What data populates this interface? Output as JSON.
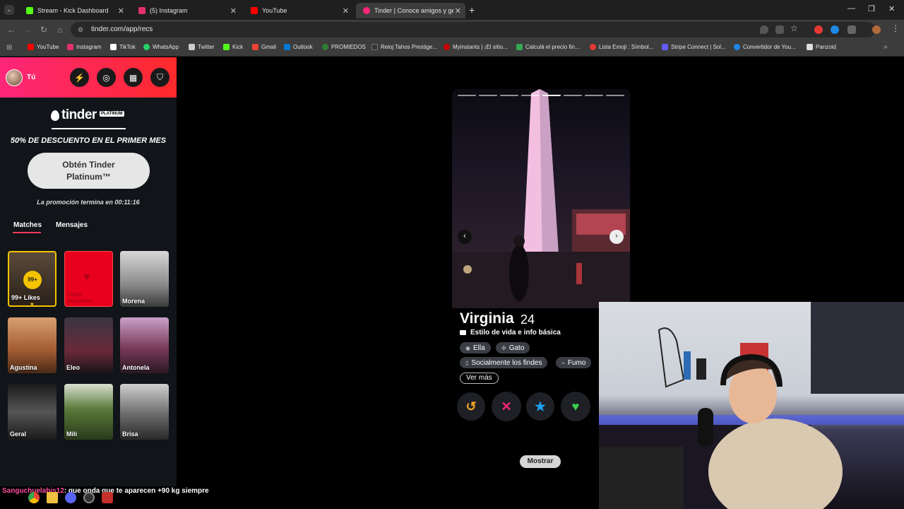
{
  "browser": {
    "tabs": [
      {
        "title": "Stream - Kick Dashboard",
        "favicon_color": "#53fc18"
      },
      {
        "title": "(5) Instagram",
        "favicon_color": "#e1306c"
      },
      {
        "title": "YouTube",
        "favicon_color": "#ff0000"
      },
      {
        "title": "Tinder | Conoce amigos y gente",
        "favicon_color": "#fd267a"
      }
    ],
    "new_tab": "+",
    "url": "tinder.com/app/recs",
    "bookmarks": [
      {
        "label": "YouTube",
        "color": "#ff0000"
      },
      {
        "label": "Instagram",
        "color": "#e1306c"
      },
      {
        "label": "TikTok",
        "color": "#ffffff"
      },
      {
        "label": "WhatsApp",
        "color": "#25d366"
      },
      {
        "label": "Twitter",
        "color": "#cccccc"
      },
      {
        "label": "Kick",
        "color": "#53fc18"
      },
      {
        "label": "Gmail",
        "color": "#ea4335"
      },
      {
        "label": "Outlook",
        "color": "#0078d4"
      },
      {
        "label": "PROMIEDOS",
        "color": "#2e7d32"
      },
      {
        "label": "Reloj Tahos Prestige...",
        "color": "#333333"
      },
      {
        "label": "Myinstants | ¡El sitio...",
        "color": "#cc0000"
      },
      {
        "label": "Calculá el precio fin...",
        "color": "#34a853"
      },
      {
        "label": "Lista Emoji : Símbol...",
        "color": "#e53935"
      },
      {
        "label": "Stripe Connect | Sol...",
        "color": "#635bff"
      },
      {
        "label": "Convertidor de You...",
        "color": "#1e88e5"
      },
      {
        "label": "Panzoid",
        "color": "#dddddd"
      }
    ]
  },
  "sidebar": {
    "user_label": "Tú",
    "brand": "tinder",
    "brand_badge": "PLATINUM",
    "discount": "50% DE DESCUENTO EN EL PRIMER MES",
    "cta": "Obtén Tinder Platinum™",
    "promo_ends": "La promoción termina en 00:11:16",
    "tabs": [
      "Matches",
      "Mensajes"
    ],
    "likes_count": "99+",
    "likes_label": "99+ Likes",
    "sent_likes_label": "Likes enviados",
    "matches": [
      "Morena",
      "Agustina",
      "Eleo",
      "Antonela",
      "Geral",
      "Mili",
      "Brisa"
    ]
  },
  "profile": {
    "name": "Virginia",
    "age": "24",
    "section": "Estilo de vida e info básica",
    "chips": [
      "Ella",
      "Gato",
      "Socialmente los findes",
      "Fumo"
    ],
    "more": "Ver más",
    "photo_count": 8,
    "photo_index": 4,
    "accent": "#fd267a",
    "show_button": "Mostrar"
  },
  "chat": {
    "user": "Sanguchuelabis12",
    "message": ": que onda que te aparecen +90 kg siempre"
  }
}
